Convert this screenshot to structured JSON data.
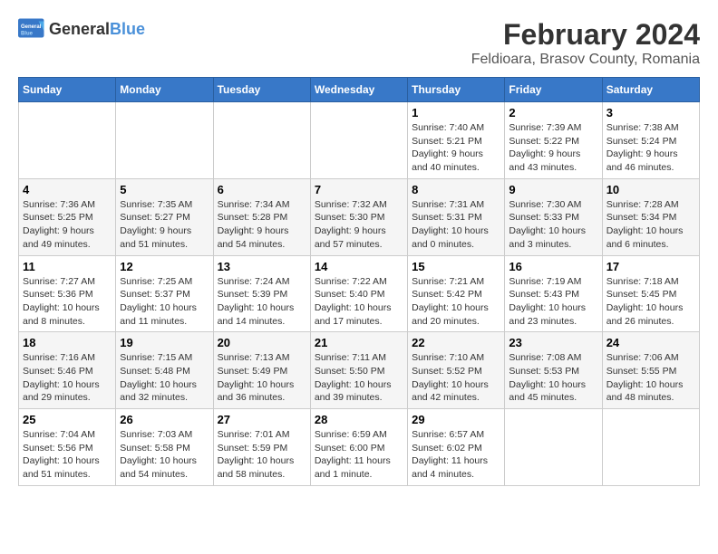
{
  "logo": {
    "general": "General",
    "blue": "Blue"
  },
  "title": "February 2024",
  "subtitle": "Feldioara, Brasov County, Romania",
  "days_of_week": [
    "Sunday",
    "Monday",
    "Tuesday",
    "Wednesday",
    "Thursday",
    "Friday",
    "Saturday"
  ],
  "weeks": [
    [
      {
        "day": "",
        "info": ""
      },
      {
        "day": "",
        "info": ""
      },
      {
        "day": "",
        "info": ""
      },
      {
        "day": "",
        "info": ""
      },
      {
        "day": "1",
        "info": "Sunrise: 7:40 AM\nSunset: 5:21 PM\nDaylight: 9 hours\nand 40 minutes."
      },
      {
        "day": "2",
        "info": "Sunrise: 7:39 AM\nSunset: 5:22 PM\nDaylight: 9 hours\nand 43 minutes."
      },
      {
        "day": "3",
        "info": "Sunrise: 7:38 AM\nSunset: 5:24 PM\nDaylight: 9 hours\nand 46 minutes."
      }
    ],
    [
      {
        "day": "4",
        "info": "Sunrise: 7:36 AM\nSunset: 5:25 PM\nDaylight: 9 hours\nand 49 minutes."
      },
      {
        "day": "5",
        "info": "Sunrise: 7:35 AM\nSunset: 5:27 PM\nDaylight: 9 hours\nand 51 minutes."
      },
      {
        "day": "6",
        "info": "Sunrise: 7:34 AM\nSunset: 5:28 PM\nDaylight: 9 hours\nand 54 minutes."
      },
      {
        "day": "7",
        "info": "Sunrise: 7:32 AM\nSunset: 5:30 PM\nDaylight: 9 hours\nand 57 minutes."
      },
      {
        "day": "8",
        "info": "Sunrise: 7:31 AM\nSunset: 5:31 PM\nDaylight: 10 hours\nand 0 minutes."
      },
      {
        "day": "9",
        "info": "Sunrise: 7:30 AM\nSunset: 5:33 PM\nDaylight: 10 hours\nand 3 minutes."
      },
      {
        "day": "10",
        "info": "Sunrise: 7:28 AM\nSunset: 5:34 PM\nDaylight: 10 hours\nand 6 minutes."
      }
    ],
    [
      {
        "day": "11",
        "info": "Sunrise: 7:27 AM\nSunset: 5:36 PM\nDaylight: 10 hours\nand 8 minutes."
      },
      {
        "day": "12",
        "info": "Sunrise: 7:25 AM\nSunset: 5:37 PM\nDaylight: 10 hours\nand 11 minutes."
      },
      {
        "day": "13",
        "info": "Sunrise: 7:24 AM\nSunset: 5:39 PM\nDaylight: 10 hours\nand 14 minutes."
      },
      {
        "day": "14",
        "info": "Sunrise: 7:22 AM\nSunset: 5:40 PM\nDaylight: 10 hours\nand 17 minutes."
      },
      {
        "day": "15",
        "info": "Sunrise: 7:21 AM\nSunset: 5:42 PM\nDaylight: 10 hours\nand 20 minutes."
      },
      {
        "day": "16",
        "info": "Sunrise: 7:19 AM\nSunset: 5:43 PM\nDaylight: 10 hours\nand 23 minutes."
      },
      {
        "day": "17",
        "info": "Sunrise: 7:18 AM\nSunset: 5:45 PM\nDaylight: 10 hours\nand 26 minutes."
      }
    ],
    [
      {
        "day": "18",
        "info": "Sunrise: 7:16 AM\nSunset: 5:46 PM\nDaylight: 10 hours\nand 29 minutes."
      },
      {
        "day": "19",
        "info": "Sunrise: 7:15 AM\nSunset: 5:48 PM\nDaylight: 10 hours\nand 32 minutes."
      },
      {
        "day": "20",
        "info": "Sunrise: 7:13 AM\nSunset: 5:49 PM\nDaylight: 10 hours\nand 36 minutes."
      },
      {
        "day": "21",
        "info": "Sunrise: 7:11 AM\nSunset: 5:50 PM\nDaylight: 10 hours\nand 39 minutes."
      },
      {
        "day": "22",
        "info": "Sunrise: 7:10 AM\nSunset: 5:52 PM\nDaylight: 10 hours\nand 42 minutes."
      },
      {
        "day": "23",
        "info": "Sunrise: 7:08 AM\nSunset: 5:53 PM\nDaylight: 10 hours\nand 45 minutes."
      },
      {
        "day": "24",
        "info": "Sunrise: 7:06 AM\nSunset: 5:55 PM\nDaylight: 10 hours\nand 48 minutes."
      }
    ],
    [
      {
        "day": "25",
        "info": "Sunrise: 7:04 AM\nSunset: 5:56 PM\nDaylight: 10 hours\nand 51 minutes."
      },
      {
        "day": "26",
        "info": "Sunrise: 7:03 AM\nSunset: 5:58 PM\nDaylight: 10 hours\nand 54 minutes."
      },
      {
        "day": "27",
        "info": "Sunrise: 7:01 AM\nSunset: 5:59 PM\nDaylight: 10 hours\nand 58 minutes."
      },
      {
        "day": "28",
        "info": "Sunrise: 6:59 AM\nSunset: 6:00 PM\nDaylight: 11 hours\nand 1 minute."
      },
      {
        "day": "29",
        "info": "Sunrise: 6:57 AM\nSunset: 6:02 PM\nDaylight: 11 hours\nand 4 minutes."
      },
      {
        "day": "",
        "info": ""
      },
      {
        "day": "",
        "info": ""
      }
    ]
  ]
}
